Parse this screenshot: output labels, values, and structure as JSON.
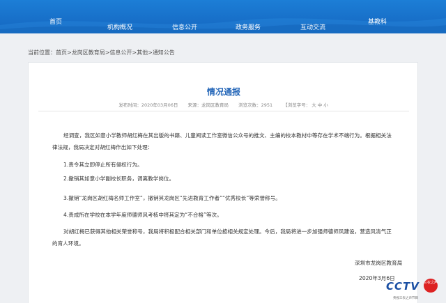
{
  "nav": {
    "items": [
      {
        "label": "首页"
      },
      {
        "label": "机构概况"
      },
      {
        "label": "信息公开"
      },
      {
        "label": "政务服务"
      },
      {
        "label": "互动交流"
      },
      {
        "label": "基教科"
      }
    ],
    "color": "#1c7ed6"
  },
  "breadcrumb": {
    "prefix": "当前位置：",
    "items": [
      "首页",
      "龙岗区教育局",
      "信息公开",
      "其他",
      "通知公告"
    ],
    "sep": ">"
  },
  "article": {
    "title": "情况通报",
    "publish_time": "发布时间：2020年03月06日",
    "source": "来源：龙岗区教育局",
    "views": "浏览次数：2951",
    "font_label": "【浏览字号：",
    "font_sizes": [
      "大",
      "中",
      "小"
    ],
    "paragraphs": [
      "经调查，我区如意小学教师胡红梅在其出版的书籍、儿童阅读工作室微信公众号的推文、主编的校本教材中等存在学术不端行为。根据相关法律法规，我局决定对胡红梅作出如下处理：",
      "1.责令其立即停止所有侵权行为。",
      "2.撤销其如意小学副校长职务，调离教学岗位。",
      "3.撤销“龙岗区胡红梅名师工作室”，撤销其龙岗区“先进教育工作者”“优秀校长”等荣誉称号。",
      "4.责成所在学校在本学年度师德师风考核中将其定为“不合格”等次。",
      "对胡红梅已获得其他相关荣誉称号，我局将积极配合相关部门和单位按相关规定处理。今后，我局将进一步加强师德师风建设，营造风清气正的育人环境。"
    ],
    "signature": "深圳市龙岗区教育局",
    "date": "2020年3月6日"
  },
  "watermark": {
    "logo": "CCTV",
    "badge": "三农之声",
    "sub": "央视三农之声节目"
  },
  "colors": {
    "title": "#2466b8",
    "nav": "#1566c0"
  }
}
